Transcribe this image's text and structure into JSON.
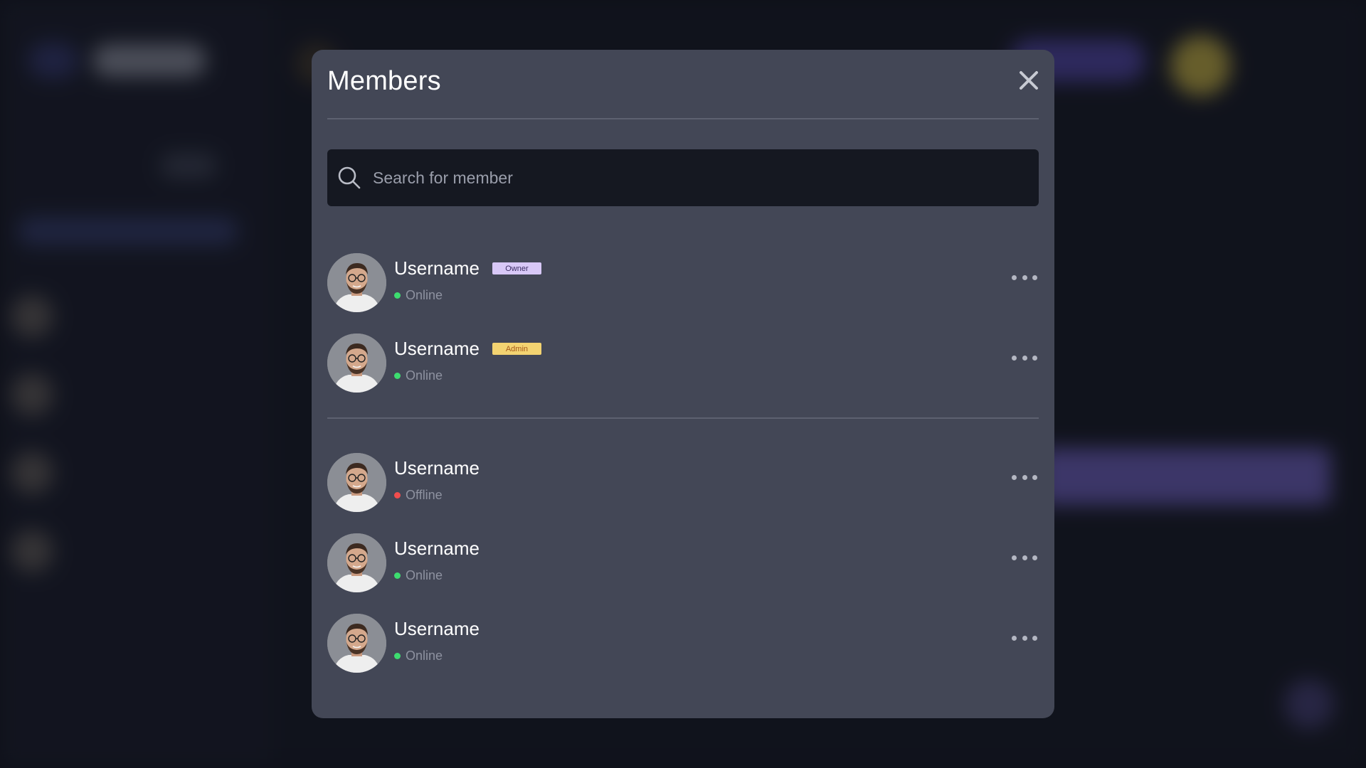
{
  "modal": {
    "title": "Members",
    "close_icon": "close-icon"
  },
  "search": {
    "placeholder": "Search for member",
    "value": "",
    "icon": "search-icon"
  },
  "colors": {
    "online": "#3ddc6f",
    "offline": "#f04d4d",
    "owner_badge": "#d8c8f7",
    "admin_badge": "#f3d371",
    "modal_bg": "#434756"
  },
  "members": {
    "staff": [
      {
        "name": "Username",
        "role": "Owner",
        "status": "Online"
      },
      {
        "name": "Username",
        "role": "Admin",
        "status": "Online"
      }
    ],
    "others": [
      {
        "name": "Username",
        "status": "Offline"
      },
      {
        "name": "Username",
        "status": "Online"
      },
      {
        "name": "Username",
        "status": "Online"
      }
    ]
  }
}
